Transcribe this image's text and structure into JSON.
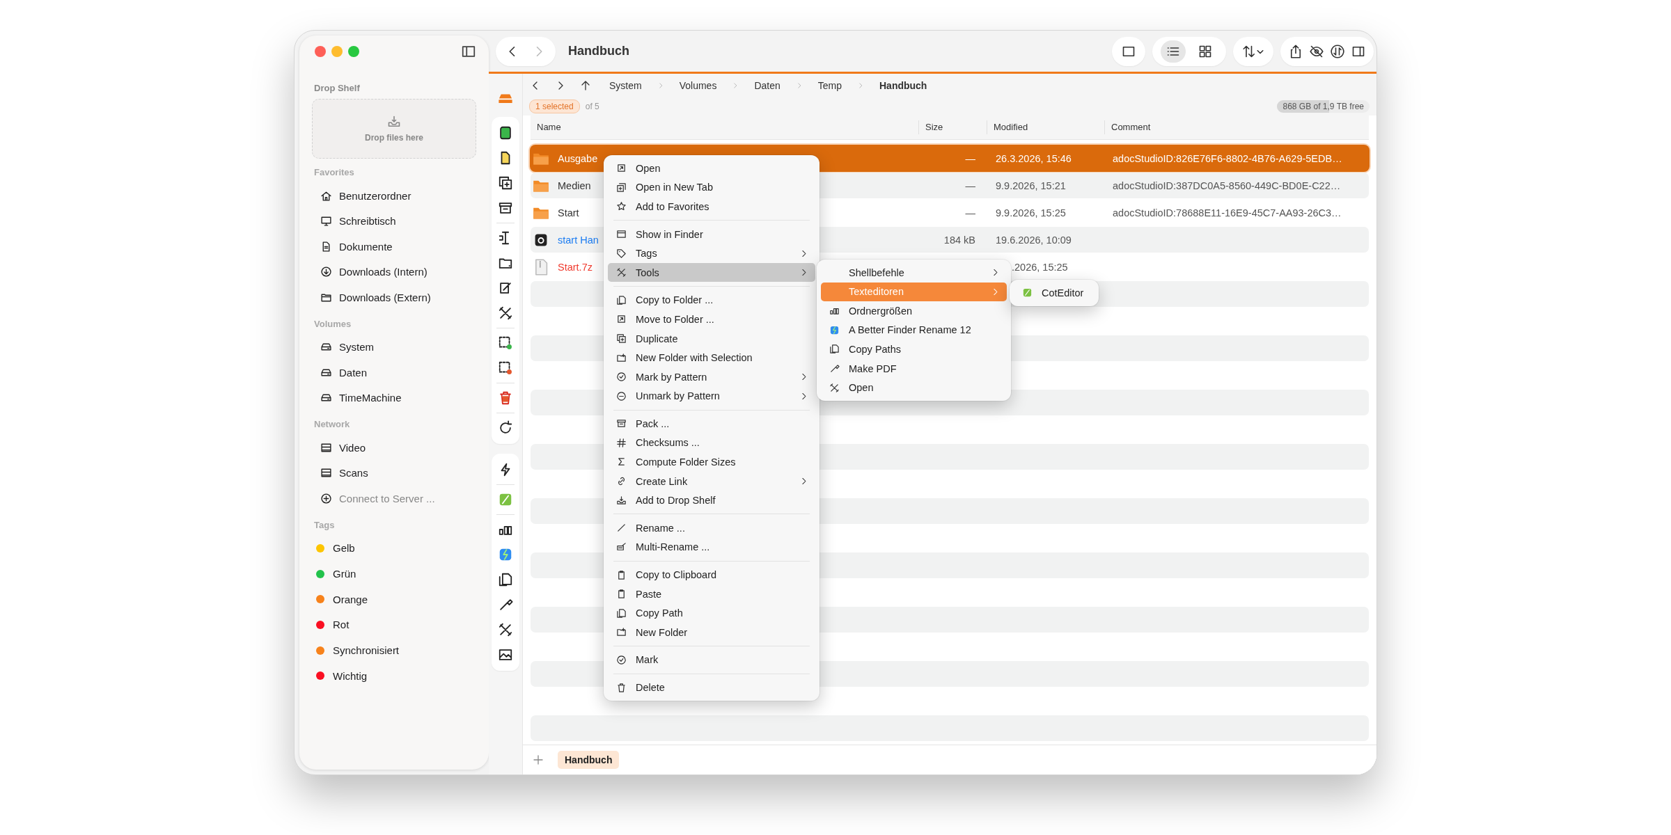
{
  "window": {
    "title": "Handbuch"
  },
  "toolbar": {
    "view_modes": [
      {
        "selected": false
      },
      {
        "selected": true
      },
      {
        "selected": false
      }
    ]
  },
  "sidebar": {
    "drop_shelf": {
      "title": "Drop Shelf",
      "hint": "Drop files here"
    },
    "favorites": {
      "title": "Favorites",
      "items": [
        {
          "label": "Benutzerordner"
        },
        {
          "label": "Schreibtisch"
        },
        {
          "label": "Dokumente"
        },
        {
          "label": "Downloads (Intern)"
        },
        {
          "label": "Downloads (Extern)"
        }
      ]
    },
    "volumes": {
      "title": "Volumes",
      "items": [
        {
          "label": "System"
        },
        {
          "label": "Daten"
        },
        {
          "label": "TimeMachine"
        }
      ]
    },
    "network": {
      "title": "Network",
      "items": [
        {
          "label": "Video",
          "disabled": false
        },
        {
          "label": "Scans",
          "disabled": false
        },
        {
          "label": "Connect to Server ...",
          "disabled": true
        }
      ]
    },
    "tags": {
      "title": "Tags",
      "items": [
        {
          "label": "Gelb",
          "color": "#fdc500"
        },
        {
          "label": "Grün",
          "color": "#22c24b"
        },
        {
          "label": "Orange",
          "color": "#f7821b"
        },
        {
          "label": "Rot",
          "color": "#fa0f22"
        },
        {
          "label": "Synchronisiert",
          "color": "#f7821b"
        },
        {
          "label": "Wichtig",
          "color": "#fa0f22"
        }
      ]
    }
  },
  "breadcrumb": {
    "segments": [
      {
        "label": "System",
        "selected": false
      },
      {
        "label": "Volumes",
        "selected": false
      },
      {
        "label": "Daten",
        "selected": false
      },
      {
        "label": "Temp",
        "selected": false
      },
      {
        "label": "Handbuch",
        "selected": true
      }
    ]
  },
  "status": {
    "selected_count": "1 selected",
    "total": "of 5",
    "disk": {
      "label": "868 GB of 1,9 TB free",
      "level": 0.56
    }
  },
  "table": {
    "columns": [
      "Name",
      "Size",
      "Modified",
      "Comment"
    ],
    "rows": [
      {
        "kind": "folder",
        "name": "Ausgabe",
        "size": "—",
        "modified": "26.3.2026, 15:46",
        "comment": "adocStudioID:826E76F6-8802-4B76-A629-5EDB…",
        "selected": true,
        "covered": false
      },
      {
        "kind": "folder",
        "name": "Medien",
        "size": "—",
        "modified": "9.9.2026, 15:21",
        "comment": "adocStudioID:387DC0A5-8560-449C-BD0E-C22…",
        "selected": false,
        "covered": false
      },
      {
        "kind": "folder",
        "name": "Start",
        "size": "—",
        "modified": "9.9.2026, 15:25",
        "comment": "adocStudioID:78688E11-16E9-45C7-AA93-26C3…",
        "selected": false,
        "covered": false
      },
      {
        "kind": "document",
        "name": "start Han",
        "size": "184 kB",
        "modified": "19.6.2026, 10:09",
        "selected": false,
        "covered": false,
        "color": "#1b7cf2"
      },
      {
        "kind": "archive",
        "name": "Start.7z",
        "modified": ".2026, 15:25",
        "selected": false,
        "covered": true,
        "color": "#f03a2e"
      }
    ]
  },
  "context_menu": {
    "groups": [
      [
        {
          "label": "Open",
          "submenu": false,
          "selected": false
        },
        {
          "label": "Open in New Tab",
          "submenu": false,
          "selected": false
        },
        {
          "label": "Add to Favorites",
          "submenu": false,
          "selected": false
        }
      ],
      [
        {
          "label": "Show in Finder",
          "submenu": false,
          "selected": false
        },
        {
          "label": "Tags",
          "submenu": true,
          "selected": false
        },
        {
          "label": "Tools",
          "submenu": true,
          "selected": true
        }
      ],
      [
        {
          "label": "Copy to Folder ...",
          "submenu": false,
          "selected": false
        },
        {
          "label": "Move to Folder ...",
          "submenu": false,
          "selected": false
        },
        {
          "label": "Duplicate",
          "submenu": false,
          "selected": false
        },
        {
          "label": "New Folder with Selection",
          "submenu": false,
          "selected": false
        },
        {
          "label": "Mark by Pattern",
          "submenu": true,
          "selected": false
        },
        {
          "label": "Unmark by Pattern",
          "submenu": true,
          "selected": false
        }
      ],
      [
        {
          "label": "Pack ...",
          "submenu": false,
          "selected": false
        },
        {
          "label": "Checksums ...",
          "submenu": false,
          "selected": false
        },
        {
          "label": "Compute Folder Sizes",
          "submenu": false,
          "selected": false
        },
        {
          "label": "Create Link",
          "submenu": true,
          "selected": false
        },
        {
          "label": "Add to Drop Shelf",
          "submenu": false,
          "selected": false
        }
      ],
      [
        {
          "label": "Rename ...",
          "submenu": false,
          "selected": false
        },
        {
          "label": "Multi-Rename ...",
          "submenu": false,
          "selected": false
        }
      ],
      [
        {
          "label": "Copy to Clipboard",
          "submenu": false,
          "selected": false
        },
        {
          "label": "Paste",
          "submenu": false,
          "selected": false
        },
        {
          "label": "Copy Path",
          "submenu": false,
          "selected": false
        },
        {
          "label": "New Folder",
          "submenu": false,
          "selected": false
        }
      ],
      [
        {
          "label": "Mark",
          "submenu": false,
          "selected": false
        }
      ],
      [
        {
          "label": "Delete",
          "submenu": false,
          "selected": false
        }
      ]
    ]
  },
  "tools_submenu": {
    "items": [
      {
        "label": "Shellbefehle",
        "submenu": true,
        "selected": false
      },
      {
        "label": "Texteditoren",
        "submenu": true,
        "selected": true
      },
      {
        "label": "Ordnergrößen",
        "submenu": false,
        "selected": false
      },
      {
        "label": "A Better Finder Rename 12",
        "submenu": false,
        "selected": false
      },
      {
        "label": "Copy Paths",
        "submenu": false,
        "selected": false
      },
      {
        "label": "Make PDF",
        "submenu": false,
        "selected": false
      },
      {
        "label": "Open",
        "submenu": false,
        "selected": false
      }
    ]
  },
  "editors_submenu": {
    "items": [
      {
        "label": "CotEditor",
        "selected": false
      }
    ]
  },
  "tab_bar": {
    "tabs": [
      {
        "label": "Handbuch",
        "selected": true
      }
    ]
  }
}
